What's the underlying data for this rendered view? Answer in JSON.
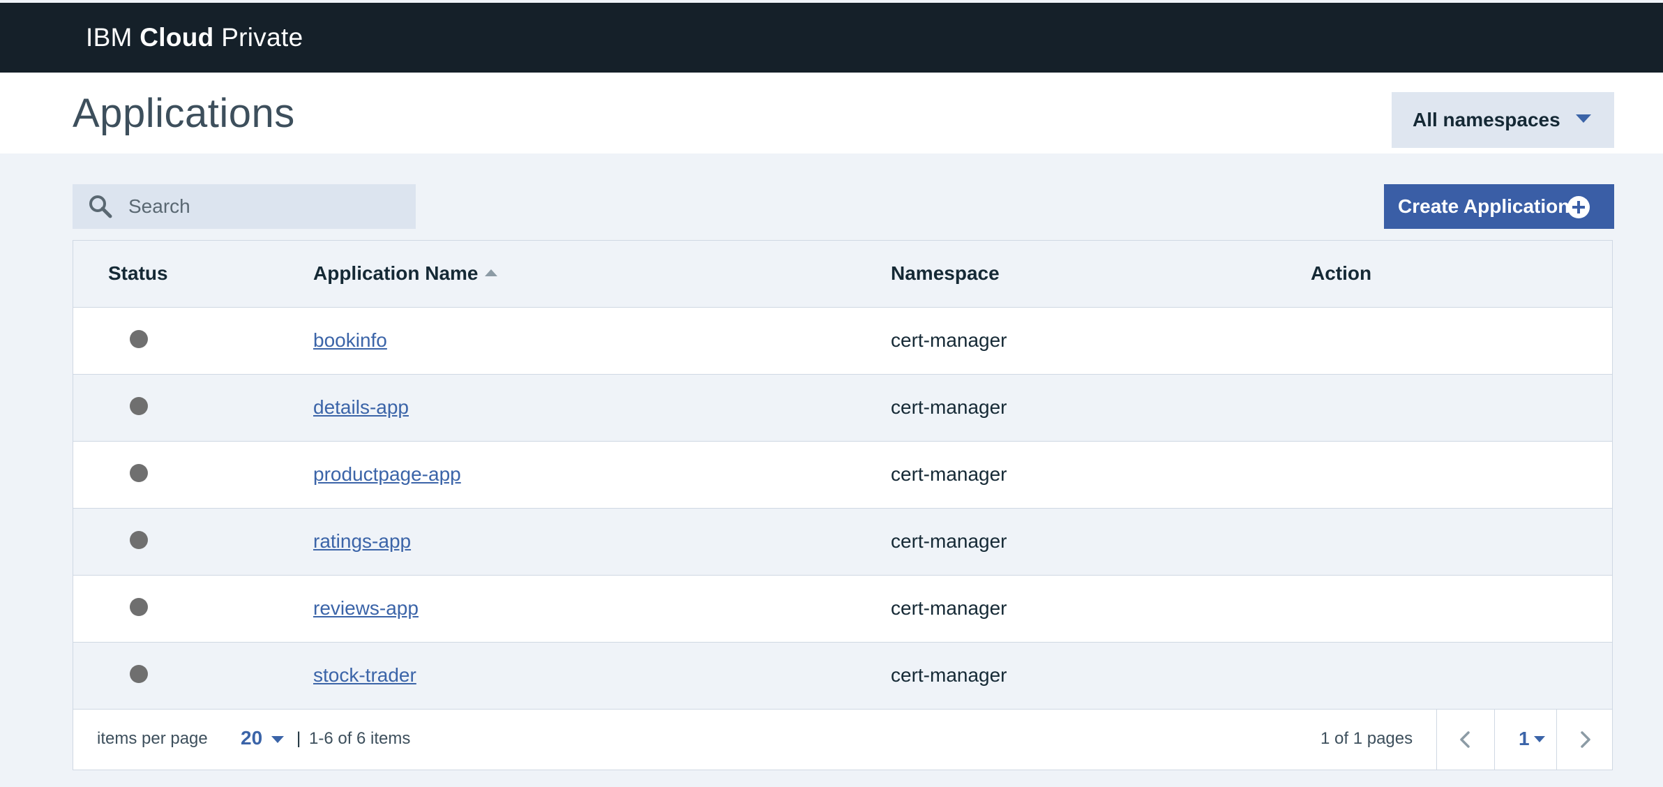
{
  "header": {
    "brand_part1": "IBM",
    "brand_part2": "Cloud",
    "brand_part3": "Private"
  },
  "page": {
    "title": "Applications",
    "namespace_filter": "All namespaces"
  },
  "toolbar": {
    "search_placeholder": "Search",
    "create_label": "Create Application"
  },
  "table": {
    "columns": [
      "Status",
      "Application Name",
      "Namespace",
      "Action"
    ],
    "sorted_column": "Application Name",
    "sort_direction": "ascending",
    "rows": [
      {
        "status": "unknown",
        "name": "bookinfo",
        "namespace": "cert-manager"
      },
      {
        "status": "unknown",
        "name": "details-app",
        "namespace": "cert-manager"
      },
      {
        "status": "unknown",
        "name": "productpage-app",
        "namespace": "cert-manager"
      },
      {
        "status": "unknown",
        "name": "ratings-app",
        "namespace": "cert-manager"
      },
      {
        "status": "unknown",
        "name": "reviews-app",
        "namespace": "cert-manager"
      },
      {
        "status": "unknown",
        "name": "stock-trader",
        "namespace": "cert-manager"
      }
    ]
  },
  "pagination": {
    "items_per_page_label": "items per page",
    "items_per_page": "20",
    "separator": "|",
    "range_text": "1-6 of 6 items",
    "pages_text": "1 of 1 pages",
    "current_page": "1"
  },
  "colors": {
    "header_bg": "#152029",
    "accent": "#3a5ea6",
    "link": "#3b64a8",
    "status_dot": "#6f6f6f",
    "page_bg": "#eff3f8"
  },
  "icons": [
    "search-icon",
    "caret-down-icon",
    "add-circle-icon",
    "sort-ascending-icon",
    "chevron-left-icon",
    "chevron-right-icon"
  ]
}
